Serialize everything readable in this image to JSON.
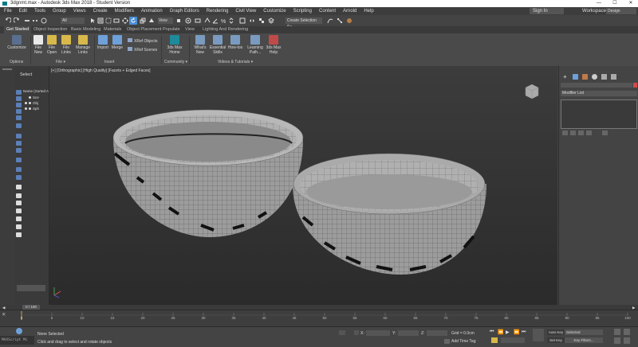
{
  "window": {
    "title": "3dgnmt.max - Autodesk 3ds Max 2018 - Student Version",
    "minimize": "—",
    "maximize": "☐",
    "close": "✕"
  },
  "menubar": {
    "items": [
      "File",
      "Edit",
      "Tools",
      "Group",
      "Views",
      "Create",
      "Modifiers",
      "Animation",
      "Graph Editors",
      "Rendering",
      "Civil View",
      "Customize",
      "Scripting",
      "Content",
      "Arnold",
      "Help"
    ],
    "signin": "Sign In",
    "workspaces_label": "Workspaces:",
    "workspace_value": "Design Standard"
  },
  "toolbar": {
    "selection_filter": "All",
    "named_selection": "Create Selection Se"
  },
  "ribbon": {
    "tabs": [
      "Get Started",
      "Object Inspection",
      "Basic Modeling",
      "Materials",
      "Object Placement",
      "Populate",
      "View",
      "Lighting And Rendering"
    ],
    "buttons": {
      "customize": "Customize",
      "file_new": "File New",
      "file_open": "File Open",
      "file_links": "File Links",
      "manage_links": "Manage Links",
      "import": "Import",
      "merge": "Merge",
      "xref_objects": "XRef Objects",
      "xref_scenes": "XRef Scenes",
      "max_home": "3ds Max Home",
      "whats_new": "What's New",
      "essential_skills": "Essential Skills",
      "how_tos": "How-tos",
      "learning_path": "Learning Path...",
      "max_help": "3ds Max Help"
    },
    "groups": {
      "options": "Options",
      "file": "File ▾",
      "insert": "Insert",
      "community": "Community ▾",
      "videos": "Videos & Tutorials ▾"
    }
  },
  "scene_explorer": {
    "select_label": "Select",
    "column": "Name (Sorted A",
    "items": [
      "Sce",
      "Obj",
      "Sph"
    ]
  },
  "viewport": {
    "label": "[+] [Orthographic] [High Quality] [Facets + Edged Faces]"
  },
  "command_panel": {
    "modifier_list": "Modifier List"
  },
  "timeline": {
    "frame_counter": "0 / 100",
    "ticks": [
      "0",
      "5",
      "10",
      "15",
      "20",
      "25",
      "30",
      "35",
      "40",
      "45",
      "50",
      "55",
      "60",
      "65",
      "70",
      "75",
      "80",
      "85",
      "90",
      "95",
      "100"
    ]
  },
  "status": {
    "maxscript": "MAXScript Mi",
    "selection": "None Selected",
    "prompt": "Click and drag to select and rotate objects",
    "x_label": "X:",
    "y_label": "Y:",
    "z_label": "Z:",
    "grid": "Grid = 0.0cm",
    "add_time_tag": "Add Time Tag",
    "auto_key": "Auto Key",
    "selected": "Selected",
    "set_key": "Set Key",
    "key_filters": "Key Filters..."
  },
  "colors": {
    "accent_blue": "#4a90d9",
    "highlight_yellow": "#d8b84a",
    "auto_key_red": "#b03030"
  }
}
